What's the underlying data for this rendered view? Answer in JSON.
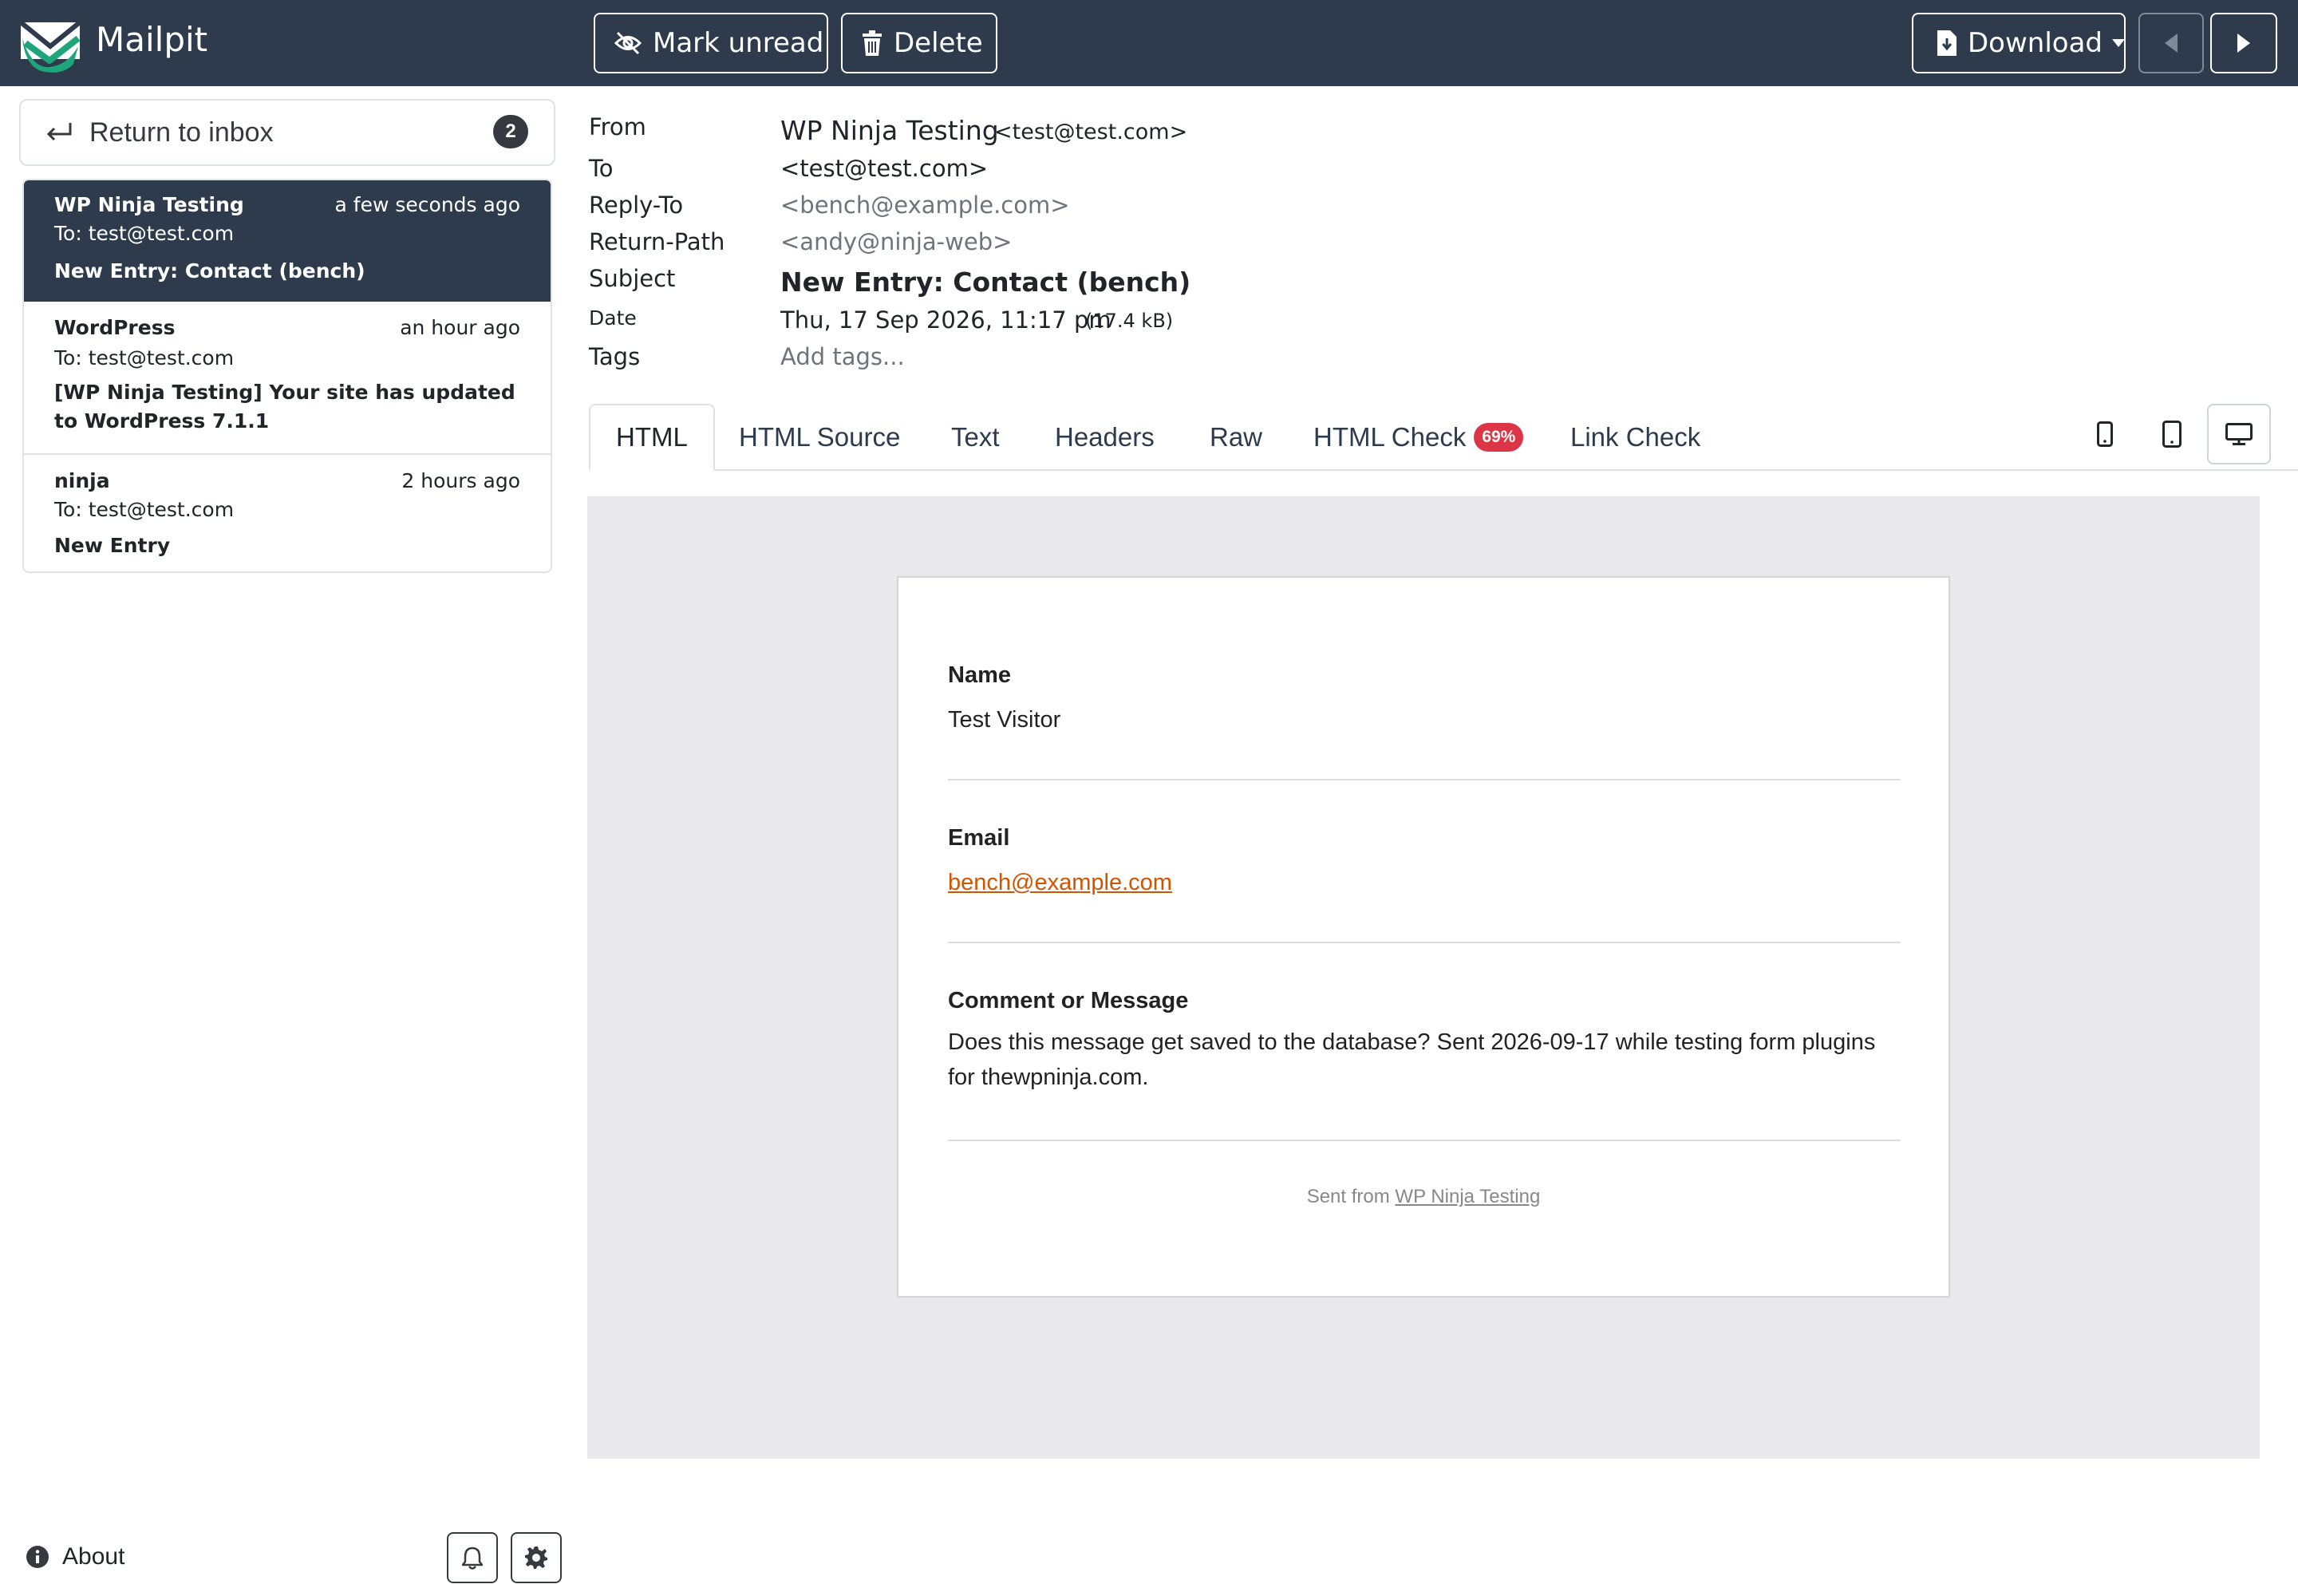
{
  "app": {
    "title": "Mailpit"
  },
  "toolbar": {
    "mark_unread": "Mark unread",
    "delete": "Delete",
    "download": "Download"
  },
  "sidebar": {
    "return_label": "Return to inbox",
    "unread_count": "2",
    "messages": [
      {
        "from": "WP Ninja Testing",
        "time": "a few seconds ago",
        "to": "To: test@test.com",
        "subject": "New Entry: Contact (bench)"
      },
      {
        "from": "WordPress",
        "time": "an hour ago",
        "to": "To: test@test.com",
        "subject": "[WP Ninja Testing] Your site has updated to WordPress 7.1.1"
      },
      {
        "from": "ninja",
        "time": "2 hours ago",
        "to": "To: test@test.com",
        "subject": "New Entry"
      }
    ],
    "about": "About"
  },
  "headers": {
    "from_label": "From",
    "from_name": "WP Ninja Testing",
    "from_email": "<test@test.com>",
    "to_label": "To",
    "to_value": "<test@test.com>",
    "replyto_label": "Reply-To",
    "replyto_value": "<bench@example.com>",
    "returnpath_label": "Return-Path",
    "returnpath_value": "<andy@ninja-web>",
    "subject_label": "Subject",
    "subject_value": "New Entry: Contact (bench)",
    "date_label": "Date",
    "date_value": "Thu, 17 Sep 2026, 11:17 pm",
    "size_value": "(17.4 kB)",
    "tags_label": "Tags",
    "tags_placeholder": "Add tags..."
  },
  "tabs": {
    "html": "HTML",
    "html_source": "HTML Source",
    "text": "Text",
    "headers": "Headers",
    "raw": "Raw",
    "html_check": "HTML Check",
    "html_check_score": "69%",
    "link_check": "Link Check"
  },
  "email_body": {
    "name_label": "Name",
    "name_value": "Test Visitor",
    "email_label": "Email",
    "email_value": "bench@example.com",
    "message_label": "Comment or Message",
    "message_value": "Does this message get saved to the database? Sent 2026-09-17 while testing form plugins for thewpninja.com.",
    "sent_from_prefix": "Sent from",
    "sent_from_link": "WP Ninja Testing"
  },
  "colors": {
    "topbar": "#2d3b4d",
    "active_item": "#2d3b4d",
    "badge_danger": "#dc3545",
    "link_orange": "#d35400",
    "preview_bg": "#e9e9eb"
  },
  "icons": [
    "mailpit-logo-icon",
    "eye-slash-icon",
    "trash-icon",
    "file-download-icon",
    "caret-down-icon",
    "caret-left-icon",
    "caret-right-icon",
    "return-arrow-icon",
    "mobile-icon",
    "tablet-icon",
    "desktop-icon",
    "info-circle-icon",
    "bell-icon",
    "gear-icon"
  ]
}
